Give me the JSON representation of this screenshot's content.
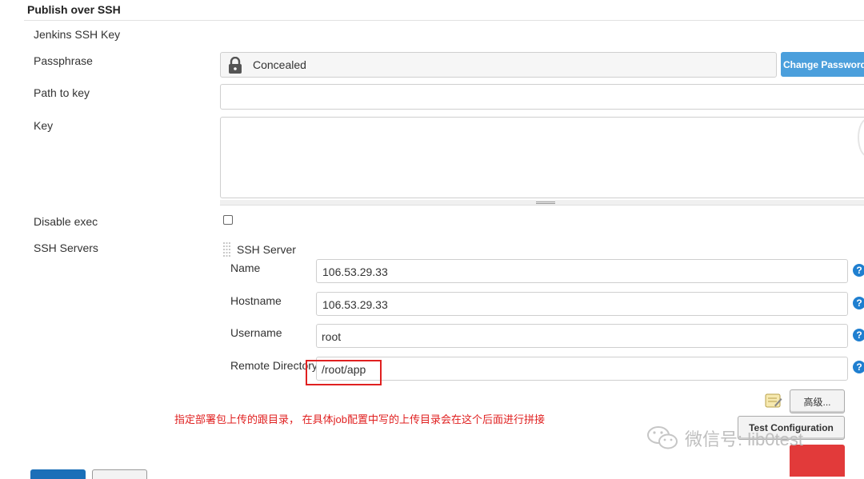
{
  "section": {
    "title": "Publish over SSH"
  },
  "labels": {
    "jenkins_ssh_key": "Jenkins SSH Key",
    "passphrase": "Passphrase",
    "path_to_key": "Path to key",
    "key": "Key",
    "disable_exec": "Disable exec",
    "ssh_servers": "SSH Servers"
  },
  "passphrase": {
    "value": "Concealed",
    "change_button": "Change Password"
  },
  "path_to_key": {
    "value": ""
  },
  "key": {
    "value": ""
  },
  "disable_exec": {
    "checked": false
  },
  "ssh_server": {
    "header": "SSH Server",
    "name_label": "Name",
    "name_value": "106.53.29.33",
    "hostname_label": "Hostname",
    "hostname_value": "106.53.29.33",
    "username_label": "Username",
    "username_value": "root",
    "remote_dir_label": "Remote Directory",
    "remote_dir_value": "/root/app",
    "help": "?",
    "advanced_button": "高级...",
    "test_button": "Test Configuration"
  },
  "annotation": {
    "text": "指定部署包上传的跟目录， 在具体job配置中写的上传目录会在这个后面进行拼接"
  },
  "watermark": {
    "text": "微信号: lib0test"
  },
  "colors": {
    "accent": "#4b9fdc",
    "annotation": "#e02020",
    "help": "#1f7fd0"
  }
}
